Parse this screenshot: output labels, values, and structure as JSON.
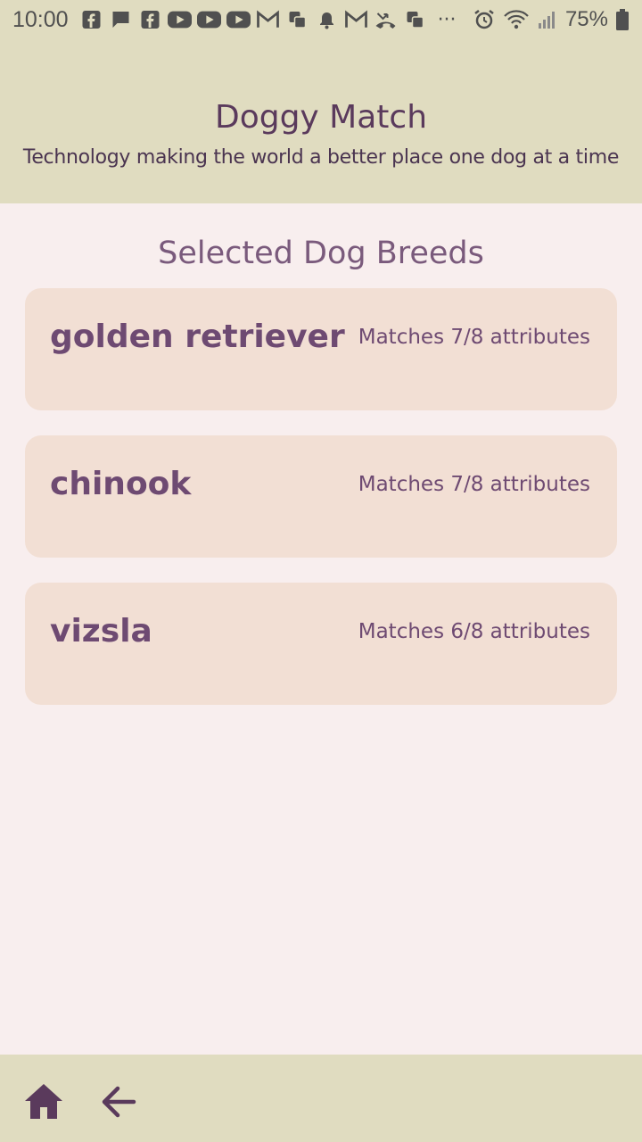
{
  "status_bar": {
    "time": "10:00",
    "battery": "75%",
    "notification_icons": [
      "facebook-icon",
      "message-icon",
      "facebook-icon",
      "youtube-icon",
      "youtube-icon",
      "youtube-icon",
      "gmail-icon",
      "copy-icon",
      "bell-icon",
      "gmail-icon",
      "missed-call-icon",
      "copy-icon",
      "more-icon"
    ],
    "more": "···"
  },
  "header": {
    "title": "Doggy Match",
    "subtitle": "Technology making the world a better place one dog at a time"
  },
  "section_title": "Selected Dog Breeds",
  "breeds": [
    {
      "name": "golden retriever",
      "match": "Matches 7/8 attributes"
    },
    {
      "name": "chinook",
      "match": "Matches 7/8 attributes"
    },
    {
      "name": "vizsla",
      "match": "Matches 6/8 attributes"
    }
  ],
  "colors": {
    "header_bg": "#e0dcc0",
    "page_bg": "#f8eeee",
    "card_bg": "#f2dfd4",
    "accent": "#6e4a72",
    "nav_icon": "#5a3a5c"
  },
  "nav": {
    "home_icon": "home-icon",
    "back_icon": "arrow-back-icon"
  }
}
